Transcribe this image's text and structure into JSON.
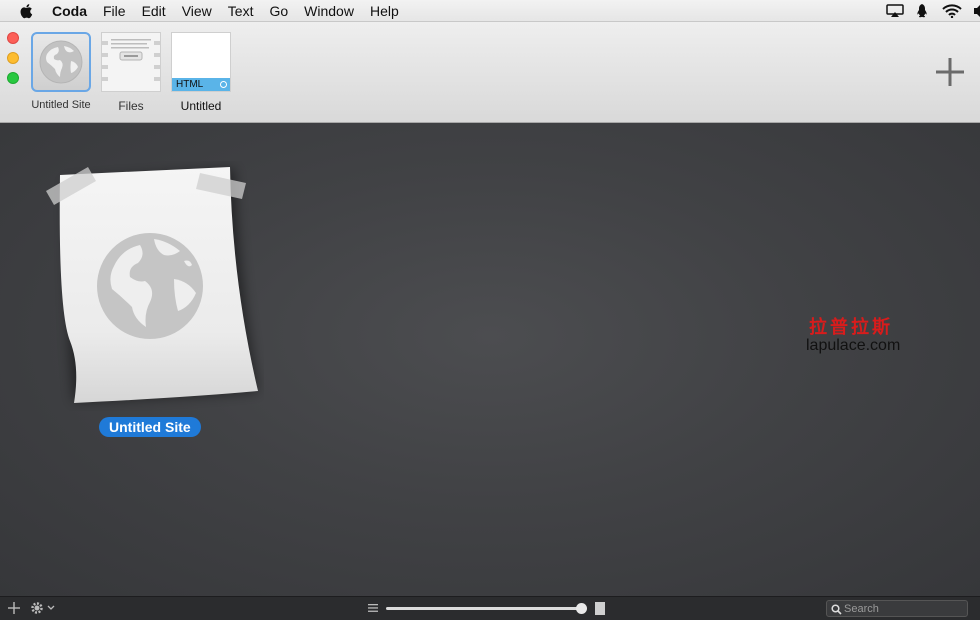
{
  "menubar": {
    "app_name": "Coda",
    "items": [
      "File",
      "Edit",
      "View",
      "Text",
      "Go",
      "Window",
      "Help"
    ],
    "status_icons": [
      "airplay-icon",
      "qq-icon",
      "wifi-icon",
      "volume-icon"
    ]
  },
  "toolbar": {
    "tabs": [
      {
        "label": "Untitled Site",
        "icon": "globe-icon"
      },
      {
        "label": "Files",
        "icon": "files-icon"
      },
      {
        "label": "Untitled",
        "badge": "HTML",
        "icon": "document-icon"
      }
    ],
    "add_icon": "plus-icon"
  },
  "main": {
    "site_label": "Untitled Site",
    "site_icon": "globe-icon",
    "watermark_cn": "拉普拉斯",
    "watermark_url": "lapulace.com"
  },
  "bottombar": {
    "search_placeholder": "Search"
  },
  "colors": {
    "accent": "#1f7ad8",
    "html_badge": "#5ab4e8",
    "close": "#fc5f57",
    "minimize": "#fdbc2f",
    "zoom": "#28c840"
  }
}
